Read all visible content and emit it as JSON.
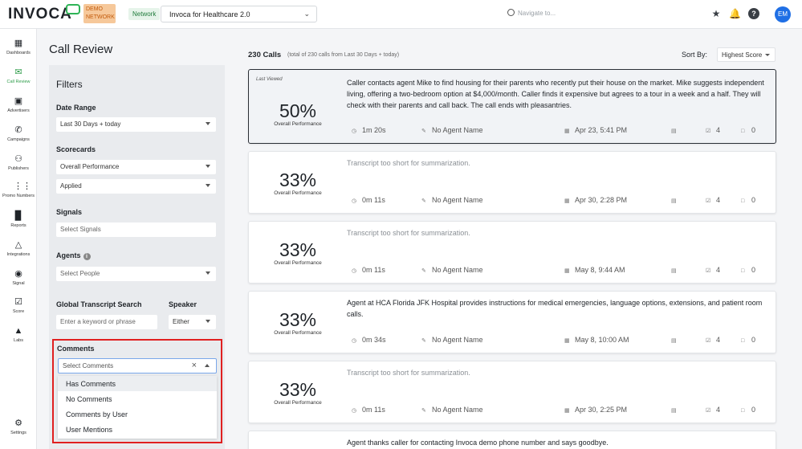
{
  "header": {
    "logo": "INVOCA",
    "demo_badge": "DEMO NETWORK",
    "network_label": "Network",
    "network_value": "Invoca for Healthcare 2.0",
    "search_placeholder": "Navigate to...",
    "avatar_initials": "EM"
  },
  "sidebar": {
    "items": [
      {
        "label": "Dashboards",
        "icon": "dashboard-icon"
      },
      {
        "label": "Call Review",
        "icon": "call-review-icon"
      },
      {
        "label": "Advertisers",
        "icon": "advertisers-icon"
      },
      {
        "label": "Campaigns",
        "icon": "campaigns-icon"
      },
      {
        "label": "Publishers",
        "icon": "publishers-icon"
      },
      {
        "label": "Promo Numbers",
        "icon": "promo-numbers-icon"
      },
      {
        "label": "Reports",
        "icon": "reports-icon"
      },
      {
        "label": "Integrations",
        "icon": "integrations-icon"
      },
      {
        "label": "Signal",
        "icon": "signal-icon"
      },
      {
        "label": "Score",
        "icon": "score-icon"
      },
      {
        "label": "Labs",
        "icon": "labs-icon"
      }
    ],
    "settings_label": "Settings"
  },
  "page": {
    "title": "Call Review"
  },
  "filters": {
    "title": "Filters",
    "date_range_label": "Date Range",
    "date_range_value": "Last 30 Days + today",
    "scorecards_label": "Scorecards",
    "scorecard_value": "Overall Performance",
    "scorecard_status": "Applied",
    "signals_label": "Signals",
    "signals_placeholder": "Select Signals",
    "agents_label": "Agents",
    "agents_placeholder": "Select People",
    "transcript_label": "Global Transcript Search",
    "transcript_placeholder": "Enter a keyword or phrase",
    "speaker_label": "Speaker",
    "speaker_value": "Either",
    "comments_label": "Comments",
    "comments_placeholder": "Select Comments",
    "comments_options": [
      "Has Comments",
      "No Comments",
      "Comments by User",
      "User Mentions"
    ]
  },
  "list": {
    "count": "230 Calls",
    "count_detail": "(total of 230 calls from Last 30 Days + today)",
    "sort_label": "Sort By:",
    "sort_value": "Highest Score",
    "last_viewed": "Last Viewed",
    "calls": [
      {
        "score": "50%",
        "score_label": "Overall Performance",
        "summary": "Caller contacts agent Mike to find housing for their parents who recently put their house on the market. Mike suggests independent living, offering a two-bedroom option at $4,000/month. Caller finds it expensive but agrees to a tour in a week and a half. They will check with their parents and call back. The call ends with pleasantries.",
        "duration": "1m 20s",
        "agent": "No Agent Name",
        "date": "Apr 23, 5:41 PM",
        "checks": "4",
        "comments": "0"
      },
      {
        "score": "33%",
        "score_label": "Overall Performance",
        "summary": "Transcript too short for summarization.",
        "duration": "0m 11s",
        "agent": "No Agent Name",
        "date": "Apr 30, 2:28 PM",
        "checks": "4",
        "comments": "0"
      },
      {
        "score": "33%",
        "score_label": "Overall Performance",
        "summary": "Transcript too short for summarization.",
        "duration": "0m 11s",
        "agent": "No Agent Name",
        "date": "May 8, 9:44 AM",
        "checks": "4",
        "comments": "0"
      },
      {
        "score": "33%",
        "score_label": "Overall Performance",
        "summary": "Agent at HCA Florida JFK Hospital provides instructions for medical emergencies, language options, extensions, and patient room calls.",
        "duration": "0m 34s",
        "agent": "No Agent Name",
        "date": "May 8, 10:00 AM",
        "checks": "4",
        "comments": "0"
      },
      {
        "score": "33%",
        "score_label": "Overall Performance",
        "summary": "Transcript too short for summarization.",
        "duration": "0m 11s",
        "agent": "No Agent Name",
        "date": "Apr 30, 2:25 PM",
        "checks": "4",
        "comments": "0"
      },
      {
        "summary": "Agent thanks caller for contacting Invoca demo phone number and says goodbye."
      }
    ]
  }
}
